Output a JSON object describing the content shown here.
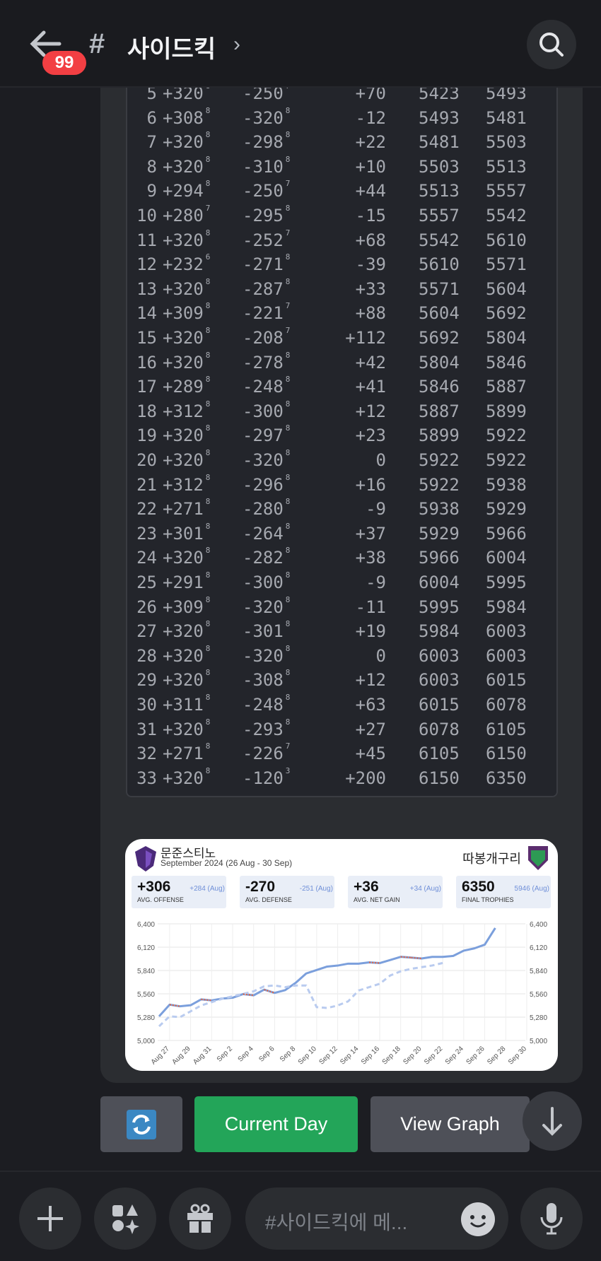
{
  "header": {
    "title": "사이드킥",
    "unread_badge": "99",
    "channel_icon": "hash-lock-icon"
  },
  "table": {
    "rows": [
      [
        "5",
        "+320",
        "8",
        "-250",
        "7",
        "+70",
        "5423",
        "5493"
      ],
      [
        "6",
        "+308",
        "8",
        "-320",
        "8",
        "-12",
        "5493",
        "5481"
      ],
      [
        "7",
        "+320",
        "8",
        "-298",
        "8",
        "+22",
        "5481",
        "5503"
      ],
      [
        "8",
        "+320",
        "8",
        "-310",
        "8",
        "+10",
        "5503",
        "5513"
      ],
      [
        "9",
        "+294",
        "8",
        "-250",
        "7",
        "+44",
        "5513",
        "5557"
      ],
      [
        "10",
        "+280",
        "7",
        "-295",
        "8",
        "-15",
        "5557",
        "5542"
      ],
      [
        "11",
        "+320",
        "8",
        "-252",
        "7",
        "+68",
        "5542",
        "5610"
      ],
      [
        "12",
        "+232",
        "6",
        "-271",
        "8",
        "-39",
        "5610",
        "5571"
      ],
      [
        "13",
        "+320",
        "8",
        "-287",
        "8",
        "+33",
        "5571",
        "5604"
      ],
      [
        "14",
        "+309",
        "8",
        "-221",
        "7",
        "+88",
        "5604",
        "5692"
      ],
      [
        "15",
        "+320",
        "8",
        "-208",
        "7",
        "+112",
        "5692",
        "5804"
      ],
      [
        "16",
        "+320",
        "8",
        "-278",
        "8",
        "+42",
        "5804",
        "5846"
      ],
      [
        "17",
        "+289",
        "8",
        "-248",
        "8",
        "+41",
        "5846",
        "5887"
      ],
      [
        "18",
        "+312",
        "8",
        "-300",
        "8",
        "+12",
        "5887",
        "5899"
      ],
      [
        "19",
        "+320",
        "8",
        "-297",
        "8",
        "+23",
        "5899",
        "5922"
      ],
      [
        "20",
        "+320",
        "8",
        "-320",
        "8",
        "0",
        "5922",
        "5922"
      ],
      [
        "21",
        "+312",
        "8",
        "-296",
        "8",
        "+16",
        "5922",
        "5938"
      ],
      [
        "22",
        "+271",
        "8",
        "-280",
        "8",
        "-9",
        "5938",
        "5929"
      ],
      [
        "23",
        "+301",
        "8",
        "-264",
        "8",
        "+37",
        "5929",
        "5966"
      ],
      [
        "24",
        "+320",
        "8",
        "-282",
        "8",
        "+38",
        "5966",
        "6004"
      ],
      [
        "25",
        "+291",
        "8",
        "-300",
        "8",
        "-9",
        "6004",
        "5995"
      ],
      [
        "26",
        "+309",
        "8",
        "-320",
        "8",
        "-11",
        "5995",
        "5984"
      ],
      [
        "27",
        "+320",
        "8",
        "-301",
        "8",
        "+19",
        "5984",
        "6003"
      ],
      [
        "28",
        "+320",
        "8",
        "-320",
        "8",
        "0",
        "6003",
        "6003"
      ],
      [
        "29",
        "+320",
        "8",
        "-308",
        "8",
        "+12",
        "6003",
        "6015"
      ],
      [
        "30",
        "+311",
        "8",
        "-248",
        "8",
        "+63",
        "6015",
        "6078"
      ],
      [
        "31",
        "+320",
        "8",
        "-293",
        "8",
        "+27",
        "6078",
        "6105"
      ],
      [
        "32",
        "+271",
        "8",
        "-226",
        "7",
        "+45",
        "6105",
        "6150"
      ],
      [
        "33",
        "+320",
        "8",
        "-120",
        "3",
        "+200",
        "6150",
        "6350"
      ]
    ]
  },
  "card": {
    "player": "문준스티노",
    "period": "September 2024 (26 Aug - 30 Sep)",
    "clan": "따봉개구리",
    "stats": [
      {
        "value": "+306",
        "compare": "+284 (Aug)",
        "label": "AVG. OFFENSE"
      },
      {
        "value": "-270",
        "compare": "-251 (Aug)",
        "label": "AVG. DEFENSE"
      },
      {
        "value": "+36",
        "compare": "+34 (Aug)",
        "label": "AVG. NET GAIN"
      },
      {
        "value": "6350",
        "compare": "5946 (Aug)",
        "label": "FINAL TROPHIES"
      }
    ]
  },
  "chart_data": {
    "type": "line",
    "x_tick_labels": [
      "Aug 27",
      "Aug 29",
      "Aug 31",
      "Sep 2",
      "Sep 4",
      "Sep 6",
      "Sep 8",
      "Sep 10",
      "Sep 12",
      "Sep 14",
      "Sep 16",
      "Sep 18",
      "Sep 20",
      "Sep 22",
      "Sep 24",
      "Sep 26",
      "Sep 28",
      "Sep 30"
    ],
    "y_ticks": [
      "5,000",
      "5,280",
      "5,560",
      "5,840",
      "6,120",
      "6,400"
    ],
    "ylim": [
      5000,
      6400
    ],
    "x_start": "Aug 26",
    "x_end": "Sep 30",
    "series": [
      {
        "style": "solid",
        "color": "#7b9fdc",
        "values": [
          5290,
          5430,
          5410,
          5423,
          5493,
          5481,
          5503,
          5513,
          5557,
          5542,
          5610,
          5571,
          5604,
          5692,
          5804,
          5846,
          5887,
          5899,
          5922,
          5922,
          5938,
          5929,
          5966,
          6004,
          5995,
          5984,
          6003,
          6003,
          6015,
          6078,
          6105,
          6150,
          6350
        ]
      },
      {
        "style": "dashed",
        "color": "#b9cbef",
        "values": [
          5170,
          5290,
          5280,
          5350,
          5420,
          5460,
          5500,
          5530,
          5560,
          5590,
          5650,
          5660,
          5640,
          5660,
          5660,
          5400,
          5390,
          5420,
          5470,
          5600,
          5640,
          5680,
          5780,
          5830,
          5860,
          5880,
          5900,
          5930
        ]
      }
    ],
    "loss_color": "#e8643c",
    "grid": true
  },
  "buttons": {
    "refresh_icon": "refresh-icon",
    "current_day": "Current Day",
    "view_graph": "View Graph"
  },
  "composer": {
    "placeholder": "#사이드킥에 메..."
  }
}
